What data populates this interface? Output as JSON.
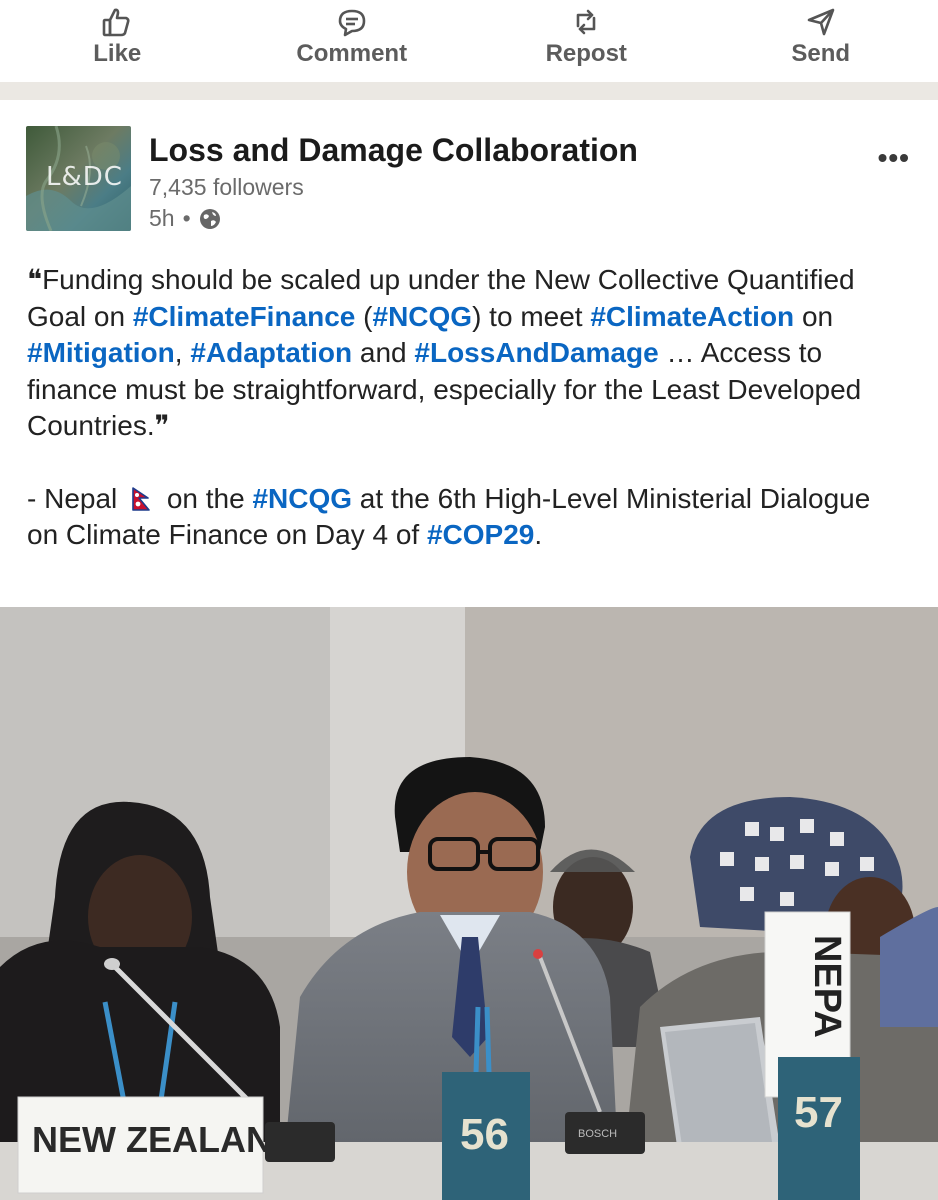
{
  "actions": [
    {
      "label": "Like",
      "icon": "thumbs-up-icon"
    },
    {
      "label": "Comment",
      "icon": "comment-icon"
    },
    {
      "label": "Repost",
      "icon": "repost-icon"
    },
    {
      "label": "Send",
      "icon": "send-icon"
    }
  ],
  "post": {
    "author": "Loss and Damage Collaboration",
    "avatar_text": "L&DC",
    "followers": "7,435 followers",
    "time": "5h",
    "separator": "•",
    "visibility_icon": "globe-icon",
    "more_label": "•••"
  },
  "body": {
    "quote_open": "❝",
    "t1": "Funding should be scaled up under the New Collective Quantified Goal on ",
    "h1": "#ClimateFinance",
    "t2": " (",
    "h2": "#NCQG",
    "t3": ") to meet ",
    "h3": "#ClimateAction",
    "t4": " on ",
    "h4": "#Mitigation",
    "t5": ", ",
    "h5": "#Adaptation",
    "t6": " and ",
    "h6": "#LossAndDamage",
    "t7": " … Access to finance must be straightforward, especially for the Least Developed Countries.",
    "quote_close": "❞",
    "p2_t1": "- Nepal ",
    "p2_t2": " on the ",
    "p2_h1": "#NCQG",
    "p2_t3": " at the 6th High-Level Ministerial Dialogue on Climate Finance on Day 4 of ",
    "p2_h2": "#COP29",
    "p2_t4": "."
  },
  "photo": {
    "placard_left": "NEW ZEALAND",
    "seat_left": "56",
    "seat_right": "57",
    "placard_right": "NEPA",
    "mic_brand": "BOSCH"
  },
  "colors": {
    "hashtag": "#0a66c2",
    "divider": "#ebe8e3",
    "placard_teal": "#2e6378"
  }
}
